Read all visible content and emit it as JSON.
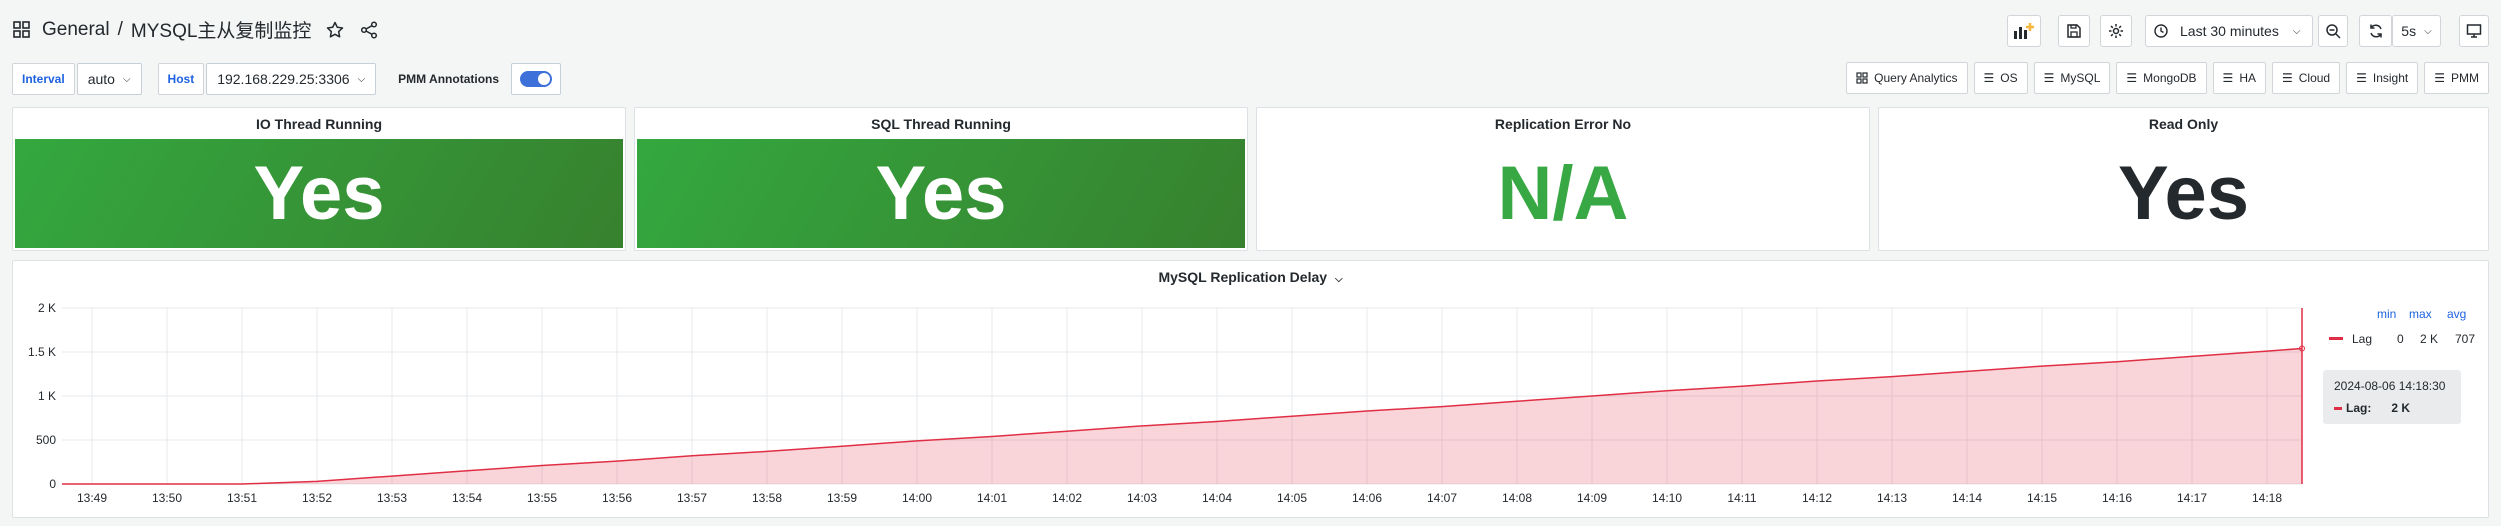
{
  "breadcrumb": {
    "folder": "General",
    "separator": "/",
    "dashboard": "MYSQL主从复制监控"
  },
  "toolbar": {
    "time_range": "Last 30 minutes",
    "refresh_interval": "5s"
  },
  "variables": {
    "interval": {
      "label": "Interval",
      "value": "auto"
    },
    "host": {
      "label": "Host",
      "value": "192.168.229.25:3306"
    },
    "annotations": {
      "label": "PMM Annotations"
    }
  },
  "links": [
    "Query Analytics",
    "OS",
    "MySQL",
    "MongoDB",
    "HA",
    "Cloud",
    "Insight",
    "PMM"
  ],
  "stats": [
    {
      "title": "IO Thread Running",
      "value": "Yes"
    },
    {
      "title": "SQL Thread Running",
      "value": "Yes"
    },
    {
      "title": "Replication Error No",
      "value": "N/A"
    },
    {
      "title": "Read Only",
      "value": "Yes"
    }
  ],
  "colors": {
    "green": "#37a843",
    "red": "#e02f44",
    "blue": "#1f62e0"
  },
  "chart": {
    "title": "MySQL Replication Delay",
    "legend_headers": [
      "min",
      "max",
      "avg"
    ],
    "legend": {
      "name": "Lag",
      "min": "0",
      "max": "2 K",
      "avg": "707"
    },
    "tooltip": {
      "time": "2024-08-06 14:18:30",
      "series": "Lag:",
      "value": "2 K"
    }
  },
  "chart_data": {
    "type": "area",
    "title": "MySQL Replication Delay",
    "x": [
      "13:49",
      "13:50",
      "13:51",
      "13:52",
      "13:53",
      "13:54",
      "13:55",
      "13:56",
      "13:57",
      "13:58",
      "13:59",
      "14:00",
      "14:01",
      "14:02",
      "14:03",
      "14:04",
      "14:05",
      "14:06",
      "14:07",
      "14:08",
      "14:09",
      "14:10",
      "14:11",
      "14:12",
      "14:13",
      "14:14",
      "14:15",
      "14:16",
      "14:17",
      "14:18"
    ],
    "y_ticks": [
      "0",
      "500",
      "1 K",
      "1.5 K",
      "2 K"
    ],
    "ylim": [
      0,
      2000
    ],
    "series": [
      {
        "name": "Lag",
        "values": [
          0,
          0,
          0,
          30,
          90,
          150,
          210,
          260,
          320,
          370,
          430,
          490,
          540,
          600,
          660,
          710,
          770,
          830,
          880,
          940,
          1000,
          1060,
          1110,
          1170,
          1220,
          1280,
          1340,
          1390,
          1450,
          1510
        ]
      }
    ],
    "final_value": 1540,
    "grid": true,
    "legend_position": "right"
  }
}
